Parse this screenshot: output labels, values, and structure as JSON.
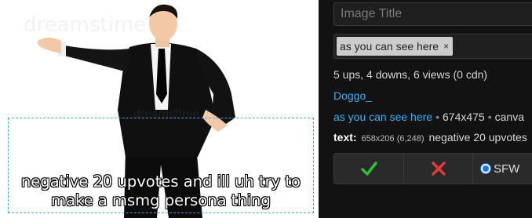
{
  "canvas": {
    "caption": "negative 20 upvotes and ill uh try to make a msmg persona thing"
  },
  "panel": {
    "title_placeholder": "Image Title",
    "tag": "as you can see here",
    "tag_remove": "×",
    "stats": "5 ups, 4 downs, 6 views (0 cdn)",
    "author": "Doggo_",
    "meta_link": "as you can see here",
    "meta_sep": "•",
    "meta_size": "674x475",
    "meta_tail": "canva",
    "text_label": "text:",
    "text_dims": "658x206 (6,248)",
    "text_value": "negative 20 upvotes",
    "sfw_label": "SFW"
  },
  "colors": {
    "link": "#3fb0f5",
    "approve": "#2fbf3a",
    "reject": "#e03b3b",
    "radio": "#1a73e8"
  },
  "icons": {
    "approve": "check-icon",
    "reject": "x-icon"
  }
}
